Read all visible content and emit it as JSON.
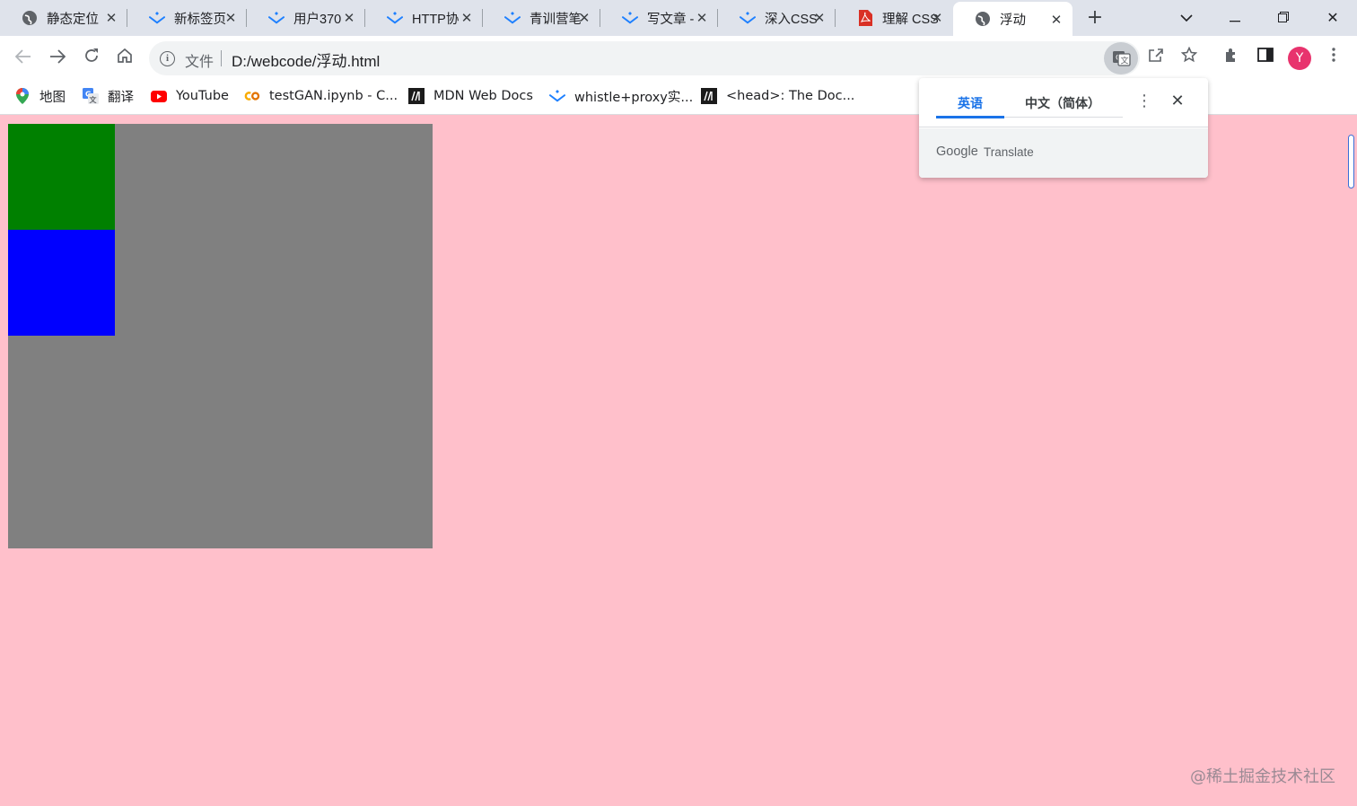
{
  "tabs": [
    {
      "title": "静态定位",
      "icon": "globe-icon"
    },
    {
      "title": "新标签页",
      "icon": "juejin-icon"
    },
    {
      "title": "用户370",
      "icon": "juejin-icon"
    },
    {
      "title": "HTTP协",
      "icon": "juejin-icon"
    },
    {
      "title": "青训营笔",
      "icon": "juejin-icon"
    },
    {
      "title": "写文章 -",
      "icon": "juejin-icon"
    },
    {
      "title": "深入CSS",
      "icon": "juejin-icon"
    },
    {
      "title": "理解 CSS",
      "icon": "pdf-icon"
    },
    {
      "title": "浮动",
      "icon": "globe-icon",
      "active": true
    }
  ],
  "toolbar": {
    "scheme_label": "文件",
    "url": "D:/webcode/浮动.html",
    "avatar_letter": "Y"
  },
  "bookmarks": [
    {
      "label": "地图",
      "icon": "maps-icon"
    },
    {
      "label": "翻译",
      "icon": "translate-icon"
    },
    {
      "label": "YouTube",
      "icon": "youtube-icon"
    },
    {
      "label": "testGAN.ipynb - C...",
      "icon": "colab-icon"
    },
    {
      "label": "MDN Web Docs",
      "icon": "mdn-icon"
    },
    {
      "label": "whistle+proxy实...",
      "icon": "juejin-icon"
    },
    {
      "label": "<head>: The Doc...",
      "icon": "mdn-icon"
    }
  ],
  "translate_popup": {
    "source_lang": "英语",
    "target_lang": "中文（简体）",
    "brand": "Google",
    "product": "Translate"
  },
  "colors": {
    "page_bg": "#ffc0cb",
    "outer_box": "#808080",
    "green_box": "#008000",
    "blue_box": "#0000ff",
    "accent": "#1a73e8"
  },
  "watermark": "@稀土掘金技术社区"
}
